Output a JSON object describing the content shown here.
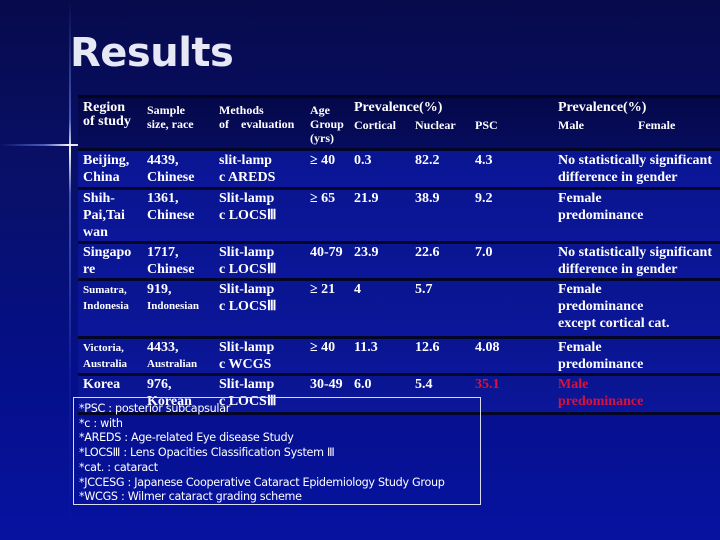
{
  "slide": {
    "title": "Results",
    "colors": {
      "background": "#08106a",
      "row_background": "#0a1590",
      "text": "#ffffff",
      "highlight_red": "#d8123a"
    }
  },
  "table": {
    "headers": {
      "region": [
        "Region",
        "of study"
      ],
      "sample": [
        "Sample",
        "size, race"
      ],
      "methods": [
        "Methods",
        "of    evaluation"
      ],
      "age": [
        "Age",
        "Group",
        "(yrs)"
      ],
      "prevalence_group": "Prevalence(%)",
      "cortical": "Cortical",
      "nuclear": "Nuclear",
      "psc": "PSC",
      "gender_group": "Prevalence(%)",
      "male": "Male",
      "female": "Female"
    },
    "rows": [
      {
        "region": [
          "Beijing,",
          "China"
        ],
        "sample": [
          "4439,",
          "Chinese"
        ],
        "method": [
          "slit-lamp",
          "c AREDS"
        ],
        "age": "≥ 40",
        "cortical": "0.3",
        "nuclear": "82.2",
        "psc": "4.3",
        "gender": [
          "No statistically significant",
          "difference in gender"
        ]
      },
      {
        "region": [
          "Shih-",
          "Pai,Tai",
          "wan"
        ],
        "sample": [
          "1361,",
          "Chinese"
        ],
        "method": [
          "Slit-lamp",
          "c LOCSⅢ"
        ],
        "age": "≥ 65",
        "cortical": "21.9",
        "nuclear": "38.9",
        "psc": "9.2",
        "gender": [
          "Female",
          "predominance"
        ]
      },
      {
        "region": [
          "Singapo",
          "re"
        ],
        "sample": [
          "1717,",
          "Chinese"
        ],
        "method": [
          "Slit-lamp",
          "c LOCSⅢ"
        ],
        "age": "40-79",
        "cortical": "23.9",
        "nuclear": "22.6",
        "psc": "7.0",
        "gender": [
          "No statistically significant",
          "difference in gender"
        ]
      },
      {
        "region": [
          "Sumatra,",
          "Indonesia"
        ],
        "sample": [
          "919,",
          "Indonesian"
        ],
        "method": [
          "Slit-lamp",
          "c LOCSⅢ"
        ],
        "age": "≥ 21",
        "cortical": "4",
        "nuclear": "5.7",
        "psc": "",
        "gender": [
          "Female",
          "predominance",
          "except cortical cat."
        ]
      },
      {
        "region": [
          "Victoria,",
          "Australia"
        ],
        "sample": [
          "4433,",
          "Australian"
        ],
        "method": [
          "Slit-lamp",
          "c WCGS"
        ],
        "age": "≥ 40",
        "cortical": "11.3",
        "nuclear": "12.6",
        "psc": "4.08",
        "gender": [
          "Female",
          "predominance"
        ]
      },
      {
        "region": [
          "Korea"
        ],
        "sample": [
          "976,",
          "Korean"
        ],
        "method": [
          "Slit-lamp",
          "c LOCSⅢ"
        ],
        "age": "30-49",
        "cortical": "6.0",
        "nuclear": "5.4",
        "psc": "35.1",
        "gender": [
          "Male",
          "predominance"
        ]
      }
    ]
  },
  "notes": [
    "*PSC : posterior subcapsular",
    "*c : with",
    "*AREDS : Age-related Eye disease Study",
    "*LOCSⅢ : Lens Opacities Classification System Ⅲ",
    "*cat. : cataract",
    "*JCCESG : Japanese Cooperative Cataract Epidemiology Study Group",
    "*WCGS : Wilmer cataract grading scheme"
  ]
}
